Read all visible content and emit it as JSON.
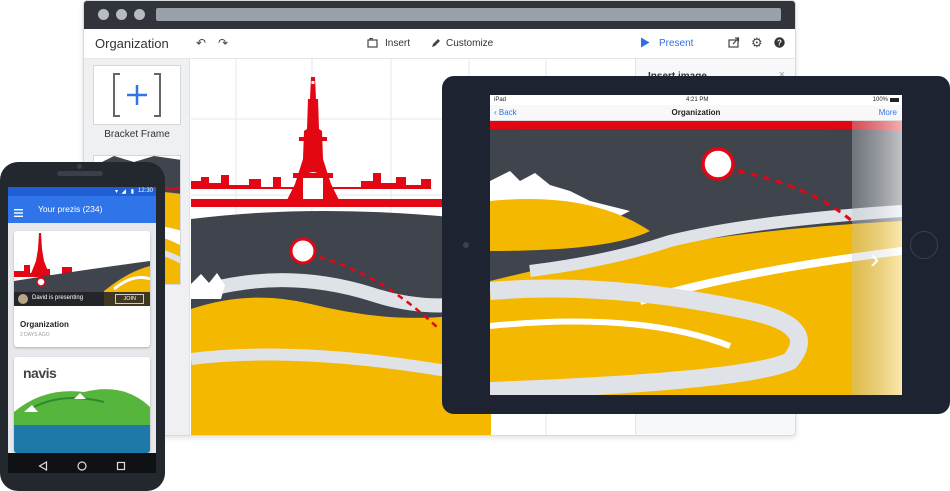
{
  "desktop": {
    "doc_title": "Organization",
    "toolbar": {
      "insert_label": "Insert",
      "customize_label": "Customize",
      "present_label": "Present"
    },
    "sidebar": {
      "frame_label": "Bracket Frame"
    },
    "panel": {
      "title": "Insert image",
      "close": "×"
    }
  },
  "tablet": {
    "status_carrier": "iPad",
    "status_time": "4:21 PM",
    "status_battery": "100%",
    "back_label": "Back",
    "title": "Organization",
    "more_label": "More",
    "next_glyph": "›"
  },
  "phone": {
    "status_time": "12:30",
    "appbar_title": "Your prezis (234)",
    "card1": {
      "presenter": "David is presenting",
      "join_label": "JOIN",
      "title": "Organization",
      "subtitle": "2 DAYS AGO"
    },
    "card2": {
      "logo_text": "navis"
    }
  },
  "colors": {
    "accent_blue": "#2f74e8",
    "eiffel_red": "#e30613",
    "road_yellow": "#f5b800",
    "hills_dark": "#3f444d",
    "road_white": "#dfe2e6"
  },
  "icons": [
    "undo-icon",
    "redo-icon",
    "insert-icon",
    "customize-pen-icon",
    "present-play-icon",
    "share-icon",
    "gear-icon",
    "help-icon",
    "hamburger-icon",
    "back-nav-icon",
    "home-nav-icon",
    "recents-nav-icon",
    "chevron-right-icon"
  ]
}
